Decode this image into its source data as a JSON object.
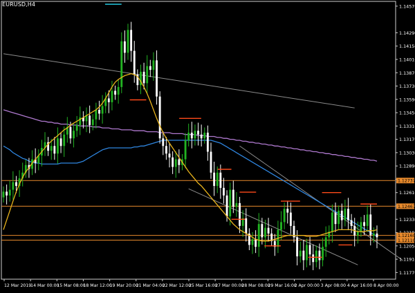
{
  "symbol_label": "EURUSD,H4",
  "colors": {
    "background": "#000000",
    "bull": "#22b422",
    "bear": "#ffffff",
    "ma_fast": "#e9b41c",
    "ma_mid": "#2f86e0",
    "ma_slow": "#b07ad0",
    "trendline": "#8c8c8c",
    "h_level": "#e88a2c",
    "resistance_dash": "#ff4a1a",
    "support_dash": "#ff4a1a",
    "top_dash": "#22c8e0",
    "price_tag_bg": "#e88a2c",
    "axis_text": "#ffffff"
  },
  "chart_data": {
    "type": "candlestick",
    "title": "EURUSD,H4",
    "ylim": [
      1.117,
      1.1462
    ],
    "y_ticks": [
      "1.14570",
      "1.14290",
      "1.14150",
      "1.14010",
      "1.13870",
      "1.13730",
      "1.13590",
      "1.13450",
      "1.13310",
      "1.13170",
      "1.13030",
      "1.12890",
      "1.12750",
      "1.12610",
      "1.12470",
      "1.12330",
      "1.12190",
      "1.12050",
      "1.11910",
      "1.11770"
    ],
    "x_labels": [
      "12 Mar 2019",
      "14 Mar 00:00",
      "15 Mar 08:00",
      "18 Mar 12:00",
      "19 Mar 20:00",
      "21 Mar 04:00",
      "22 Mar 12:00",
      "25 Mar 16:00",
      "27 Mar 00:00",
      "28 Mar 08:00",
      "29 Mar 16:00",
      "2 Apr 00:00",
      "3 Apr 08:00",
      "4 Apr 16:00",
      "8 Apr 00:00"
    ],
    "closes": [
      1.1262,
      1.1258,
      1.1264,
      1.1272,
      1.1268,
      1.1276,
      1.1282,
      1.129,
      1.1286,
      1.1296,
      1.1292,
      1.13,
      1.1308,
      1.1314,
      1.1305,
      1.131,
      1.1302,
      1.1318,
      1.131,
      1.1322,
      1.133,
      1.1318,
      1.1326,
      1.1332,
      1.134,
      1.1336,
      1.1342,
      1.1332,
      1.1338,
      1.1348,
      1.1344,
      1.1352,
      1.136,
      1.1356,
      1.1368,
      1.1364,
      1.1372,
      1.142,
      1.1408,
      1.1432,
      1.141,
      1.1385,
      1.1374,
      1.1388,
      1.1376,
      1.1394,
      1.139,
      1.14,
      1.1362,
      1.1318,
      1.131,
      1.1302,
      1.1298,
      1.1288,
      1.1296,
      1.129,
      1.1296,
      1.1316,
      1.1324,
      1.1318,
      1.1326,
      1.1322,
      1.1318,
      1.1324,
      1.1304,
      1.1282,
      1.1268,
      1.1282,
      1.1266,
      1.1258,
      1.1236,
      1.1264,
      1.1246,
      1.125,
      1.1226,
      1.1234,
      1.1218,
      1.1206,
      1.1212,
      1.1204,
      1.1228,
      1.1214,
      1.1224,
      1.1218,
      1.121,
      1.1204,
      1.1222,
      1.123,
      1.1244,
      1.124,
      1.1226,
      1.1214,
      1.1194,
      1.12,
      1.119,
      1.1206,
      1.1196,
      1.1188,
      1.12,
      1.119,
      1.1204,
      1.1214,
      1.122,
      1.124,
      1.1228,
      1.1242,
      1.1232,
      1.1244,
      1.1232,
      1.1226,
      1.1216,
      1.122,
      1.123,
      1.1226,
      1.1238,
      1.1216,
      1.1218,
      1.1214
    ],
    "ma_fast": [
      1.1222,
      1.1232,
      1.1242,
      1.1252,
      1.1262,
      1.127,
      1.1277,
      1.1283,
      1.1287,
      1.1292,
      1.1296,
      1.13,
      1.1304,
      1.1308,
      1.1312,
      1.1315,
      1.1318,
      1.1321,
      1.1324,
      1.1327,
      1.1329,
      1.1332,
      1.1334,
      1.1336,
      1.1338,
      1.134,
      1.1342,
      1.1344,
      1.1346,
      1.1348,
      1.1351,
      1.1355,
      1.136,
      1.1366,
      1.1372,
      1.1377,
      1.138,
      1.1382,
      1.1384,
      1.1385,
      1.1386,
      1.1385,
      1.1383,
      1.1378,
      1.1372,
      1.1365,
      1.1357,
      1.1348,
      1.1339,
      1.1331,
      1.1324,
      1.1318,
      1.1313,
      1.1308,
      1.1303,
      1.1298,
      1.1293,
      1.1288,
      1.1283,
      1.1279,
      1.1275,
      1.1271,
      1.1268,
      1.1264,
      1.126,
      1.1256,
      1.1252,
      1.1248,
      1.1244,
      1.124,
      1.1236,
      1.1232,
      1.1228,
      1.1225,
      1.1222,
      1.122,
      1.1218,
      1.1216,
      1.1214,
      1.1212,
      1.1211,
      1.121,
      1.121,
      1.121,
      1.1211,
      1.1212,
      1.1213,
      1.1214,
      1.1215,
      1.1216,
      1.1216,
      1.1216,
      1.1216,
      1.1216,
      1.1216,
      1.1215,
      1.1215,
      1.1215,
      1.1215,
      1.1216,
      1.1217,
      1.1218,
      1.1219,
      1.122,
      1.1221,
      1.1222,
      1.1222,
      1.1222,
      1.1222,
      1.1222,
      1.1221,
      1.122,
      1.122,
      1.122,
      1.1221,
      1.1221,
      1.1221,
      1.1222
    ],
    "ma_mid": [
      1.131,
      1.1308,
      1.1306,
      1.1303,
      1.1301,
      1.1299,
      1.1297,
      1.1296,
      1.1294,
      1.1293,
      1.1292,
      1.1292,
      1.1291,
      1.1291,
      1.1291,
      1.1291,
      1.1291,
      1.1291,
      1.1292,
      1.1292,
      1.1292,
      1.1292,
      1.1292,
      1.1292,
      1.1293,
      1.1294,
      1.1296,
      1.1298,
      1.13,
      1.1302,
      1.1304,
      1.1306,
      1.1307,
      1.1308,
      1.1308,
      1.1308,
      1.1308,
      1.1308,
      1.1308,
      1.1308,
      1.1308,
      1.1309,
      1.1309,
      1.131,
      1.131,
      1.1311,
      1.1312,
      1.1313,
      1.1314,
      1.1315,
      1.1316,
      1.1316,
      1.1316,
      1.1316,
      1.1316,
      1.1316,
      1.1316,
      1.1316,
      1.1316,
      1.1316,
      1.1316,
      1.1316,
      1.1316,
      1.1316,
      1.1316,
      1.1316,
      1.1315,
      1.1314,
      1.1313,
      1.1311,
      1.1309,
      1.1307,
      1.1305,
      1.1303,
      1.1301,
      1.1299,
      1.1297,
      1.1295,
      1.1293,
      1.1291,
      1.1289,
      1.1287,
      1.1285,
      1.1283,
      1.1281,
      1.1279,
      1.1277,
      1.1275,
      1.1273,
      1.1271,
      1.1269,
      1.1267,
      1.1265,
      1.1263,
      1.1261,
      1.1259,
      1.1257,
      1.1255,
      1.1253,
      1.1251,
      1.1249,
      1.1247,
      1.1245,
      1.1243,
      1.1241,
      1.1239,
      1.1237,
      1.1235,
      1.1233,
      1.1231,
      1.1229,
      1.1227,
      1.1225,
      1.1223,
      1.1221,
      1.1219,
      1.1217,
      1.1215
    ],
    "ma_slow": [
      1.1348,
      1.1347,
      1.1346,
      1.1345,
      1.1344,
      1.1343,
      1.1342,
      1.1341,
      1.134,
      1.1339,
      1.1338,
      1.1337,
      1.1336,
      1.1336,
      1.1335,
      1.1335,
      1.1334,
      1.1334,
      1.1333,
      1.1333,
      1.1333,
      1.1332,
      1.1332,
      1.1332,
      1.1331,
      1.1331,
      1.1331,
      1.1331,
      1.133,
      1.133,
      1.133,
      1.1329,
      1.1329,
      1.1329,
      1.1328,
      1.1328,
      1.1328,
      1.1327,
      1.1327,
      1.1327,
      1.1327,
      1.1326,
      1.1326,
      1.1326,
      1.1326,
      1.1325,
      1.1325,
      1.1325,
      1.1325,
      1.1324,
      1.1324,
      1.1324,
      1.1324,
      1.1323,
      1.1323,
      1.1323,
      1.1323,
      1.1322,
      1.1322,
      1.1322,
      1.1322,
      1.1321,
      1.1321,
      1.1321,
      1.132,
      1.132,
      1.132,
      1.1319,
      1.1319,
      1.1318,
      1.1318,
      1.1317,
      1.1317,
      1.1316,
      1.1316,
      1.1315,
      1.1315,
      1.1314,
      1.1314,
      1.1313,
      1.1313,
      1.1312,
      1.1312,
      1.1311,
      1.1311,
      1.131,
      1.131,
      1.1309,
      1.1309,
      1.1308,
      1.1308,
      1.1307,
      1.1307,
      1.1306,
      1.1306,
      1.1305,
      1.1305,
      1.1304,
      1.1304,
      1.1303,
      1.1303,
      1.1302,
      1.1302,
      1.1301,
      1.1301,
      1.13,
      1.13,
      1.1299,
      1.1299,
      1.1298,
      1.1298,
      1.1297,
      1.1297,
      1.1296,
      1.1296,
      1.1295,
      1.1295,
      1.1294
    ],
    "horizontal_levels": [
      {
        "price": 1.12737,
        "label": "1.12737"
      },
      {
        "price": 1.12467,
        "label": "1.12467"
      },
      {
        "price": 1.1216,
        "label": "1.12160"
      },
      {
        "price": 1.1211,
        "label": "1.12110"
      }
    ],
    "trendlines": [
      {
        "x0": 0,
        "y0": 1.1407,
        "x1": 110,
        "y1": 1.135
      },
      {
        "x0": 74,
        "y0": 1.131,
        "x1": 125,
        "y1": 1.119
      },
      {
        "x0": 58,
        "y0": 1.1265,
        "x1": 111,
        "y1": 1.1185
      }
    ],
    "dash_levels": [
      {
        "i0": 46,
        "i1": 52,
        "price": 1.13585,
        "kind": "top"
      },
      {
        "i0": 64,
        "i1": 72,
        "price": 1.1339,
        "kind": "resistance"
      },
      {
        "i0": 78,
        "i1": 83,
        "price": 1.12855,
        "kind": "resistance"
      },
      {
        "i0": 86,
        "i1": 92,
        "price": 1.12615,
        "kind": "resistance"
      },
      {
        "i0": 101,
        "i1": 108,
        "price": 1.1252,
        "kind": "resistance"
      },
      {
        "i0": 116,
        "i1": 123,
        "price": 1.1261,
        "kind": "resistance"
      },
      {
        "i0": 130,
        "i1": 136,
        "price": 1.1249,
        "kind": "resistance"
      },
      {
        "i0": 83,
        "i1": 88,
        "price": 1.1233,
        "kind": "support"
      },
      {
        "i0": 95,
        "i1": 101,
        "price": 1.1205,
        "kind": "support"
      },
      {
        "i0": 111,
        "i1": 116,
        "price": 1.1193,
        "kind": "support"
      },
      {
        "i0": 122,
        "i1": 127,
        "price": 1.1206,
        "kind": "support"
      },
      {
        "i0": 37,
        "i1": 43,
        "price": 1.1459,
        "kind": "top_cyan"
      }
    ],
    "current_price_label": "1.12160",
    "xlabel": "",
    "ylabel": ""
  }
}
